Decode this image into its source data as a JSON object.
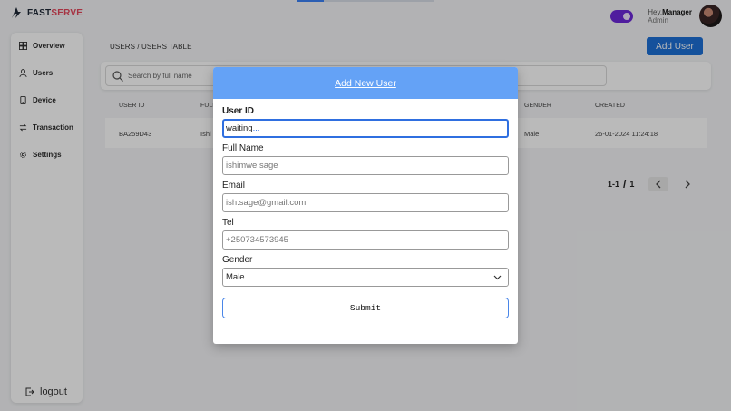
{
  "brand": {
    "part1": "FAST",
    "part2": "SERVE",
    "accent": "#e4465b"
  },
  "user": {
    "greeting": "Hey,",
    "name": "Manager",
    "role": "Admin"
  },
  "sidebar": {
    "items": [
      {
        "label": "Overview",
        "icon": "grid-icon"
      },
      {
        "label": "Users",
        "icon": "user-icon"
      },
      {
        "label": "Device",
        "icon": "device-icon"
      },
      {
        "label": "Transaction",
        "icon": "transfer-icon"
      },
      {
        "label": "Settings",
        "icon": "gear-icon"
      }
    ],
    "logout_label": "logout"
  },
  "breadcrumb": "USERS / USERS TABLE",
  "add_user_label": "Add User",
  "search": {
    "placeholder": "Search by full name"
  },
  "table": {
    "headers": [
      "USER ID",
      "FULL",
      "GENDER",
      "CREATED"
    ],
    "rows": [
      {
        "user_id": "BA259D43",
        "full_name": "Ishi",
        "gender": "Male",
        "created": "26-01-2024 11:24:18"
      }
    ]
  },
  "pagination": {
    "range": "1-1",
    "total": "1"
  },
  "modal": {
    "title": "Add New User",
    "fields": {
      "user_id": {
        "label": "User ID",
        "value": "waiting",
        "dots": "..."
      },
      "full_name": {
        "label": "Full Name",
        "placeholder": "ishimwe sage"
      },
      "email": {
        "label": "Email",
        "placeholder": "ish.sage@gmail.com"
      },
      "tel": {
        "label": "Tel",
        "placeholder": "+250734573945"
      },
      "gender": {
        "label": "Gender",
        "value": "Male"
      }
    },
    "submit_label": "Submit"
  },
  "colors": {
    "primary": "#1d6fd6",
    "modal_header": "#64a2f6",
    "toggle": "#6d28d9"
  }
}
